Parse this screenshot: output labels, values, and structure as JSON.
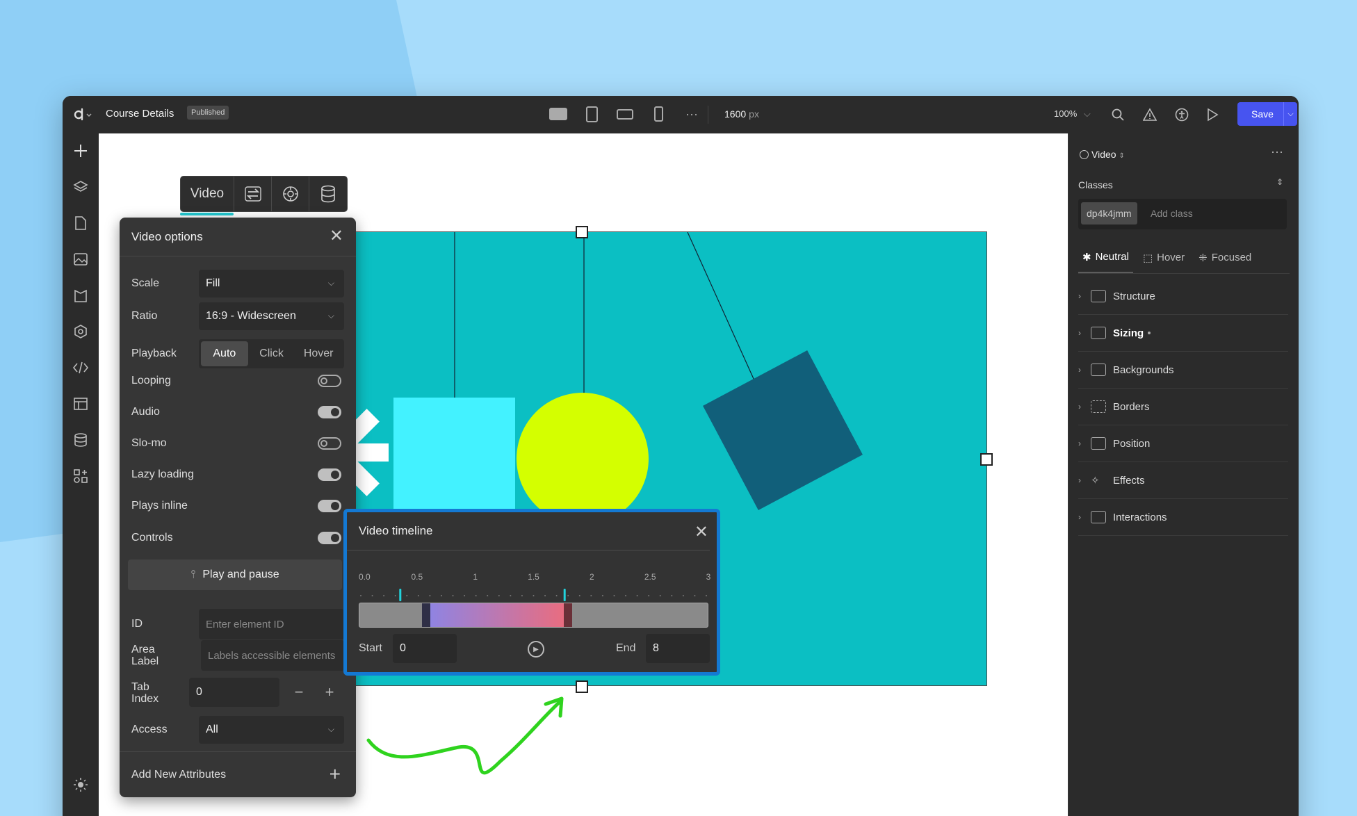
{
  "app": {
    "project_name": "Course Details",
    "status_badge": "Published",
    "canvas_width": "1600",
    "canvas_width_unit": "px",
    "zoom": "100%",
    "save_label": "Save"
  },
  "selection_toolbar": {
    "element_label": "Video"
  },
  "video_options": {
    "title": "Video options",
    "scale_label": "Scale",
    "scale_value": "Fill",
    "ratio_label": "Ratio",
    "ratio_value": "16:9 - Widescreen",
    "playback_label": "Playback",
    "playback_options": [
      "Auto",
      "Click",
      "Hover"
    ],
    "playback_selected": "Auto",
    "toggles": [
      {
        "label": "Looping",
        "on": false
      },
      {
        "label": "Audio",
        "on": true
      },
      {
        "label": "Slo-mo",
        "on": false
      },
      {
        "label": "Lazy loading",
        "on": true
      },
      {
        "label": "Plays inline",
        "on": true
      },
      {
        "label": "Controls",
        "on": true
      }
    ],
    "play_pause_label": "Play and pause",
    "id_label": "ID",
    "id_placeholder": "Enter element ID",
    "area_label_label_1": "Area",
    "area_label_label_2": "Label",
    "area_label_placeholder": "Labels accessible elements",
    "tab_index_label_1": "Tab",
    "tab_index_label_2": "Index",
    "tab_index_value": "0",
    "access_label": "Access",
    "access_value": "All",
    "add_attributes_label": "Add New Attributes"
  },
  "timeline": {
    "title": "Video timeline",
    "tick_labels": [
      "0.0",
      "0.5",
      "1",
      "1.5",
      "2",
      "2.5",
      "3"
    ],
    "range_start_fraction": 0.1,
    "range_end_fraction": 0.57,
    "start_label": "Start",
    "start_value": "0",
    "end_label": "End",
    "end_value": "8"
  },
  "right_panel": {
    "element_type": "Video",
    "classes_label": "Classes",
    "class_chip": "dp4k4jmm",
    "add_class_placeholder": "Add class",
    "states": [
      "Neutral",
      "Hover",
      "Focused"
    ],
    "active_state": "Neutral",
    "sections": [
      "Structure",
      "Sizing",
      "Backgrounds",
      "Borders",
      "Position",
      "Effects",
      "Interactions"
    ],
    "bold_section": "Sizing"
  },
  "colors": {
    "accent": "#4754f0",
    "video_bg": "#0bbfc3",
    "timeline_border": "#1479d3",
    "arrow": "#2fd31e"
  }
}
